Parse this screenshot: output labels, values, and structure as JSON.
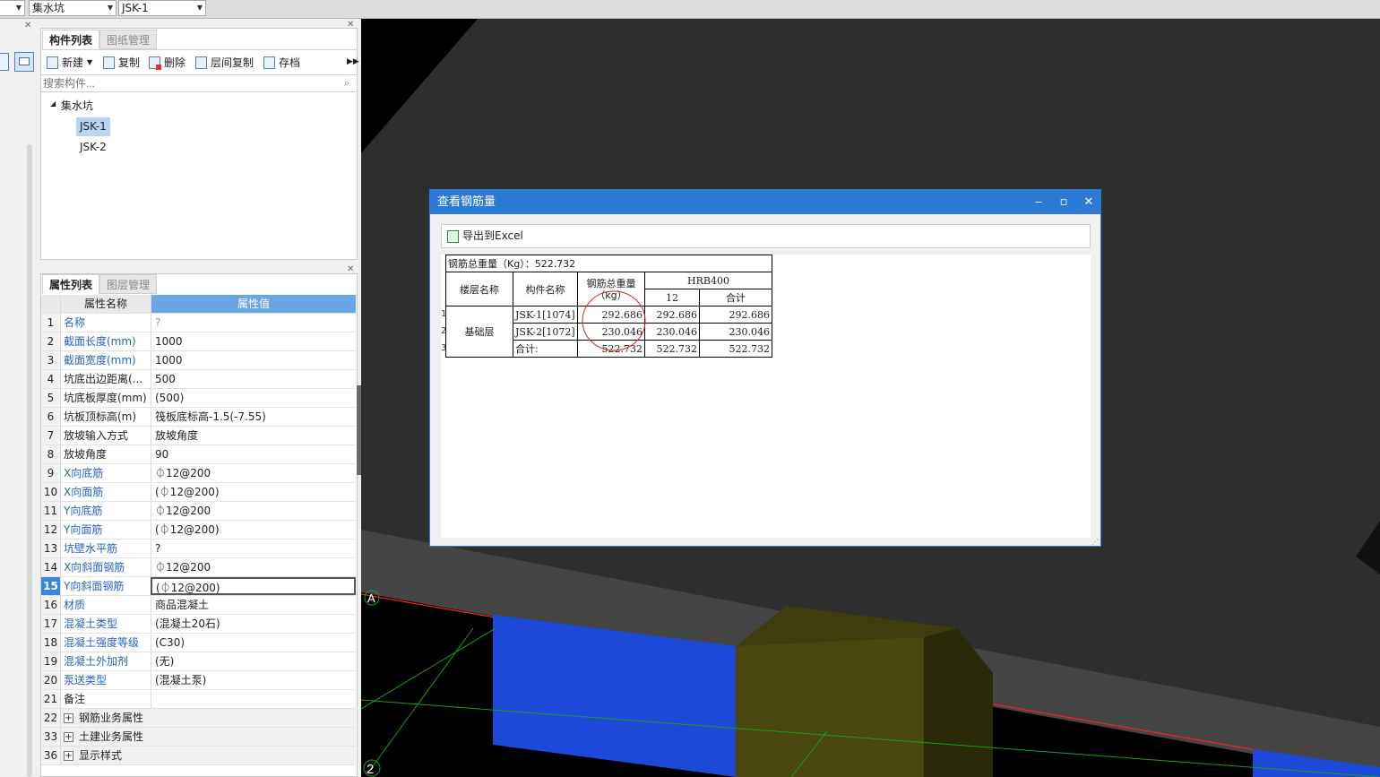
{
  "topbar": {
    "combo1": "集水坑",
    "combo2": "JSK-1"
  },
  "component_panel": {
    "tabs": [
      "构件列表",
      "图纸管理"
    ],
    "toolbar": {
      "new": "新建",
      "copy": "复制",
      "delete": "删除",
      "floor_copy": "层间复制",
      "archive": "存档"
    },
    "search_placeholder": "搜索构件...",
    "tree": {
      "root": "集水坑",
      "items": [
        "JSK-1",
        "JSK-2"
      ],
      "selected": "JSK-1"
    }
  },
  "property_panel": {
    "tabs": [
      "属性列表",
      "图层管理"
    ],
    "header": {
      "name": "属性名称",
      "value": "属性值"
    },
    "rows": [
      {
        "num": "1",
        "name": "名称",
        "value": "?",
        "blue": true
      },
      {
        "num": "2",
        "name": "截面长度(mm)",
        "value": "1000",
        "blue": true
      },
      {
        "num": "3",
        "name": "截面宽度(mm)",
        "value": "1000",
        "blue": true
      },
      {
        "num": "4",
        "name": "坑底出边距离(...",
        "value": "500",
        "blue": false
      },
      {
        "num": "5",
        "name": "坑底板厚度(mm)",
        "value": "(500)",
        "blue": false
      },
      {
        "num": "6",
        "name": "坑板顶标高(m)",
        "value": "筏板底标高-1.5(-7.55)",
        "blue": false
      },
      {
        "num": "7",
        "name": "放坡输入方式",
        "value": "放坡角度",
        "blue": false
      },
      {
        "num": "8",
        "name": "放坡角度",
        "value": "90",
        "blue": false
      },
      {
        "num": "9",
        "name": "X向底筋",
        "value": "⏀12@200",
        "blue": true
      },
      {
        "num": "10",
        "name": "X向面筋",
        "value": "(⏀12@200)",
        "blue": true
      },
      {
        "num": "11",
        "name": "Y向底筋",
        "value": "⏀12@200",
        "blue": true
      },
      {
        "num": "12",
        "name": "Y向面筋",
        "value": "(⏀12@200)",
        "blue": true
      },
      {
        "num": "13",
        "name": "坑壁水平筋",
        "value": "?",
        "blue": true
      },
      {
        "num": "14",
        "name": "X向斜面钢筋",
        "value": "⏀12@200",
        "blue": true
      },
      {
        "num": "15",
        "name": "Y向斜面钢筋",
        "value": "(⏀12@200)",
        "blue": true
      },
      {
        "num": "16",
        "name": "材质",
        "value": "商品混凝土",
        "blue": true
      },
      {
        "num": "17",
        "name": "混凝土类型",
        "value": "(混凝土20石)",
        "blue": true
      },
      {
        "num": "18",
        "name": "混凝土强度等级",
        "value": "(C30)",
        "blue": true
      },
      {
        "num": "19",
        "name": "混凝土外加剂",
        "value": "(无)",
        "blue": true
      },
      {
        "num": "20",
        "name": "泵送类型",
        "value": "(混凝土泵)",
        "blue": true
      },
      {
        "num": "21",
        "name": "备注",
        "value": "",
        "blue": false
      }
    ],
    "groups": [
      {
        "num": "22",
        "name": "钢筋业务属性"
      },
      {
        "num": "33",
        "name": "土建业务属性"
      },
      {
        "num": "36",
        "name": "显示样式"
      }
    ]
  },
  "viewport": {
    "axis_labels": [
      "A",
      "2"
    ]
  },
  "dialog": {
    "title": "查看钢筋量",
    "export_label": "导出到Excel",
    "report": {
      "total_line": "钢筋总重量（Kg）：522.732",
      "headers": {
        "floor": "楼层名称",
        "component": "构件名称",
        "weight": "钢筋总重量（kg）",
        "grade": "HRB400",
        "dia": "12",
        "sum": "合计"
      },
      "floor": "基础层",
      "row_numbers": [
        "1",
        "2",
        "3"
      ],
      "rows": [
        {
          "component": "JSK-1[1074]",
          "weight": "292.686",
          "d12": "292.686",
          "sum": "292.686"
        },
        {
          "component": "JSK-2[1072]",
          "weight": "230.046",
          "d12": "230.046",
          "sum": "230.046"
        },
        {
          "component": "合计:",
          "weight": "522.732",
          "d12": "522.732",
          "sum": "522.732"
        }
      ]
    }
  },
  "colors": {
    "accent": "#2a7ad6",
    "header_blue": "#6aa6e3",
    "link_blue": "#2a62c6",
    "viewport_bg": "#2e2e2e"
  }
}
